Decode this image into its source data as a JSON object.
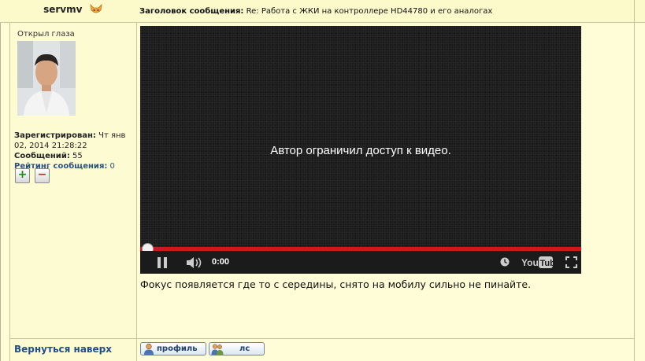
{
  "post": {
    "author": "servmv",
    "subject_label": "Заголовок сообщения:",
    "subject": "Re: Работа с ЖКИ на контроллере HD44780 и его аналогах",
    "rank": "Открыл глаза",
    "registered_label": "Зарегистрирован:",
    "registered_value": "Чт янв",
    "registered_value2": "02, 2014 21:28:22",
    "messages_label": "Сообщений:",
    "messages_value": "55",
    "rating_label": "Рейтинг сообщения:",
    "rating_value": "0",
    "vote_plus": "+",
    "vote_minus": "−",
    "text": "Фокус появляется где то с середины, снято на мобилу сильно не пинайте."
  },
  "video": {
    "message": "Автор ограничил доступ к видео.",
    "time": "0:00",
    "progress_fraction": 0,
    "logo_text": "YouTube"
  },
  "footer": {
    "back_to_top": "Вернуться наверх",
    "profile_button": "профиль",
    "pm_button": "лс"
  },
  "colors": {
    "page_bg": "#fefdd7",
    "link": "#1f4f8a",
    "progress": "#cc181e"
  }
}
